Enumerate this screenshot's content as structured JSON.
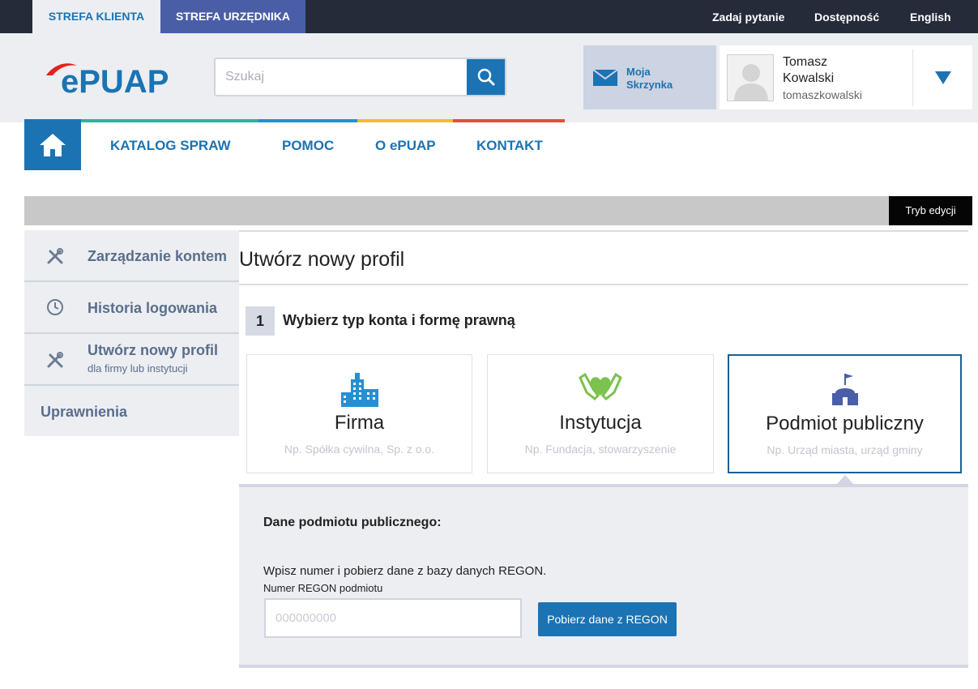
{
  "topbar": {
    "client_zone": "STREFA KLIENTA",
    "official_zone": "STREFA URZĘDNIKA",
    "ask_question": "Zadaj pytanie",
    "accessibility": "Dostępność",
    "language": "English"
  },
  "header": {
    "logo_text": "ePUAP",
    "search_placeholder": "Szukaj",
    "mailbox_label_line1": "Moja",
    "mailbox_label_line2": "Skrzynka",
    "user": {
      "first_name": "Tomasz",
      "last_name": "Kowalski",
      "login": "tomaszkowalski"
    }
  },
  "nav": {
    "items": [
      "KATALOG SPRAW",
      "POMOC",
      "O ePUAP",
      "KONTAKT"
    ],
    "stripe_colors": [
      "#2db29c",
      "#2490d4",
      "#f1bd2c",
      "#e34e3f"
    ]
  },
  "edit_mode": "Tryb edycji",
  "sidebar": {
    "items": [
      {
        "label": "Zarządzanie kontem",
        "icon": "tools-icon"
      },
      {
        "label": "Historia logowania",
        "icon": "clock-icon"
      },
      {
        "label": "Utwórz nowy profil",
        "sublabel": "dla firmy lub instytucji",
        "icon": "tools-icon"
      },
      {
        "label": "Uprawnienia"
      }
    ]
  },
  "main": {
    "title": "Utwórz nowy profil",
    "step_number": "1",
    "step_title": "Wybierz typ konta i formę prawną",
    "cards": [
      {
        "title": "Firma",
        "subtitle": "Np. Spółka cywilna, Sp. z o.o.",
        "icon": "buildings-icon",
        "icon_color": "#2490d4"
      },
      {
        "title": "Instytucja",
        "subtitle": "Np. Fundacja, stowarzyszenie",
        "icon": "hands-heart-icon",
        "icon_color": "#7cc24e"
      },
      {
        "title": "Podmiot publiczny",
        "subtitle": "Np. Urząd miasta, urząd gminy",
        "icon": "public-building-icon",
        "icon_color": "#4a5ea8",
        "selected": true
      }
    ],
    "panel": {
      "heading": "Dane podmiotu publicznego:",
      "instruction": "Wpisz numer i pobierz dane z bazy danych REGON.",
      "field_label": "Numer REGON podmiotu",
      "field_placeholder": "000000000",
      "button_label": "Pobierz dane z REGON"
    }
  },
  "colors": {
    "brand_blue": "#1b73b3",
    "topbar_dark": "#262b3a",
    "official_tab": "#4a5ea8",
    "header_bg": "#eceef2"
  }
}
